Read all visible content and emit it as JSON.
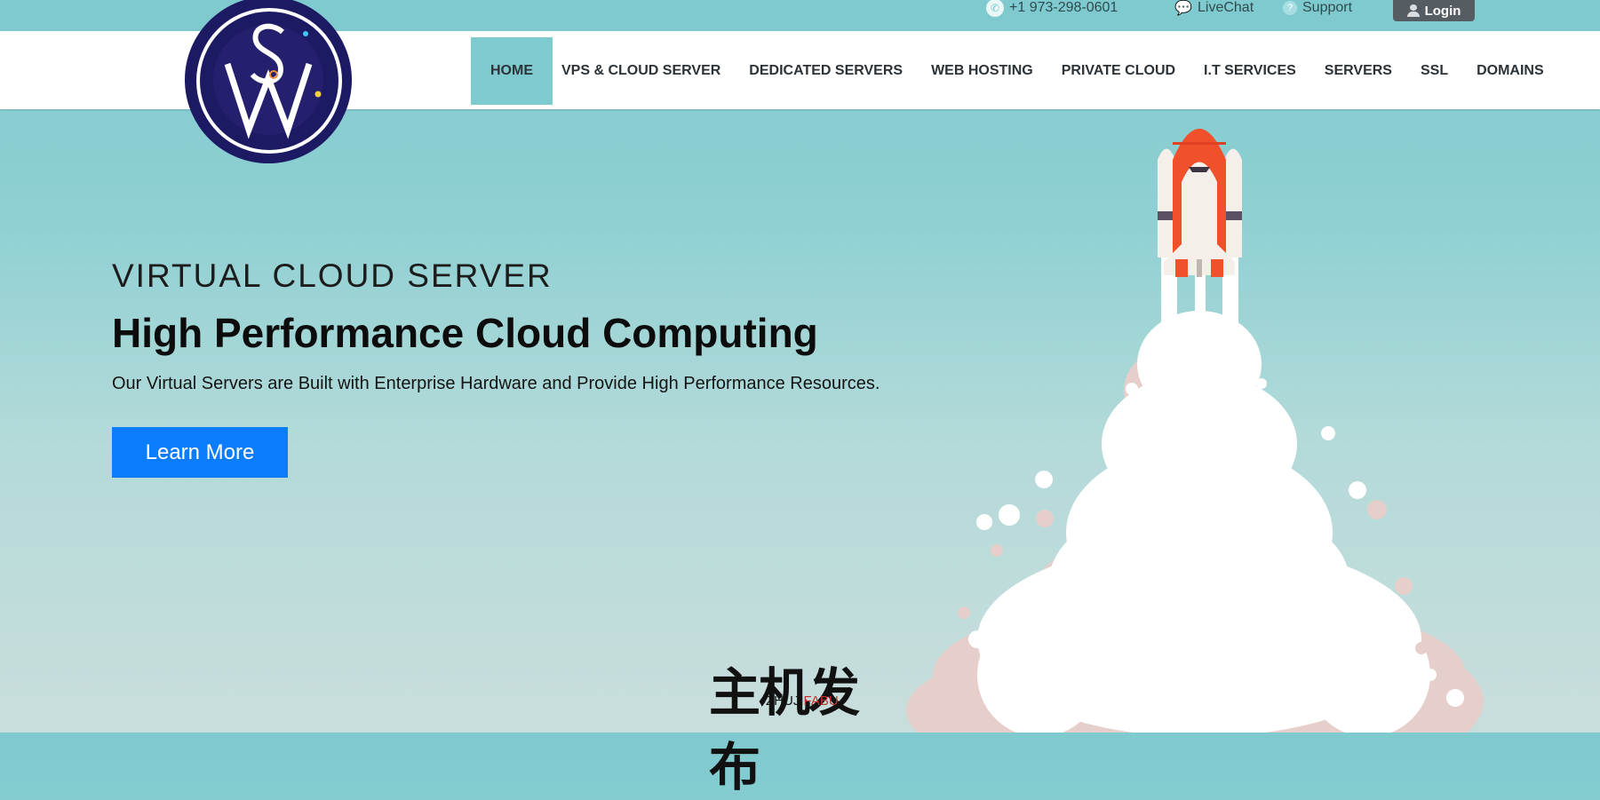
{
  "topbar": {
    "phone": "+1 973-298-0601",
    "livechat": "LiveChat",
    "support": "Support",
    "login": "Login"
  },
  "nav": {
    "items": [
      "HOME",
      "VPS & CLOUD SERVER",
      "DEDICATED SERVERS",
      "WEB HOSTING",
      "PRIVATE CLOUD",
      "I.T SERVICES",
      "SERVERS",
      "SSL",
      "DOMAINS"
    ],
    "active": "HOME"
  },
  "hero": {
    "eyebrow": "VIRTUAL CLOUD SERVER",
    "title": "High Performance Cloud Computing",
    "subtitle": "Our Virtual Servers are Built with Enterprise Hardware and Provide High Performance Resources.",
    "cta": "Learn More"
  },
  "watermark": {
    "chinese": "主机发布",
    "latin_black": "ZHUJI",
    "latin_red": "FABU"
  },
  "colors": {
    "accent": "#7fcacf",
    "cta": "#0b7dfa",
    "logo_bg": "#1d1a64"
  }
}
